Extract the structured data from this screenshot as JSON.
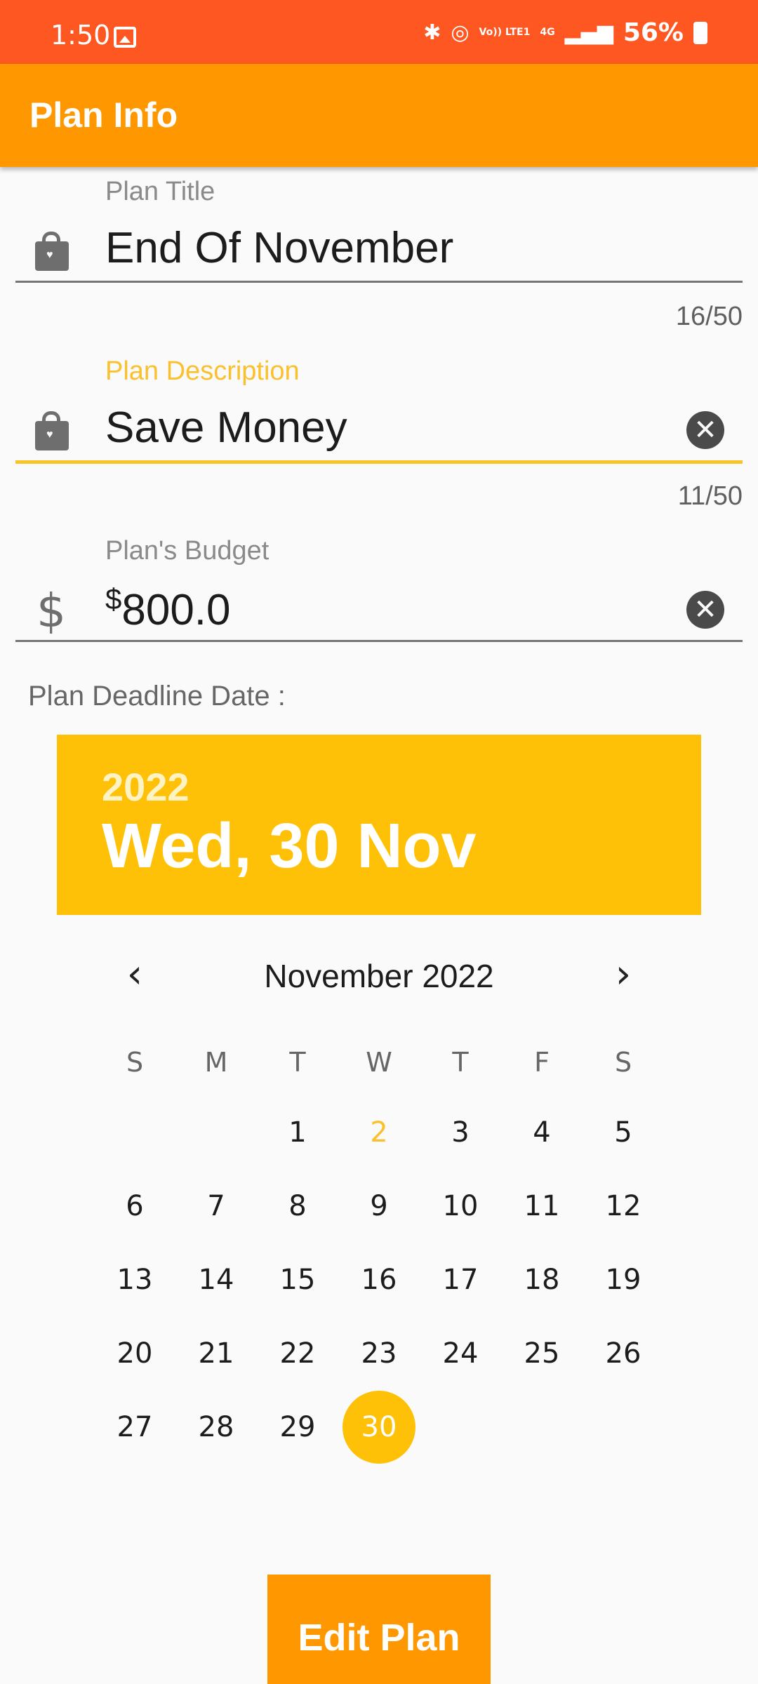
{
  "status_bar": {
    "time": "1:50",
    "battery": "56%",
    "network": "4G",
    "volte": "Vo)) LTE1"
  },
  "app_bar": {
    "title": "Plan Info"
  },
  "fields": {
    "title": {
      "label": "Plan Title",
      "value": "End Of November",
      "counter": "16/50",
      "icon": "shopping-bag-icon"
    },
    "description": {
      "label": "Plan Description",
      "value": "Save Money",
      "counter": "11/50",
      "icon": "shopping-bag-icon"
    },
    "budget": {
      "label": "Plan's Budget",
      "value": "800.0",
      "currency": "$",
      "icon": "dollar-icon"
    }
  },
  "deadline_label": "Plan Deadline Date :",
  "date_picker": {
    "year": "2022",
    "selected_date": "Wed, 30 Nov",
    "month_title": "November 2022",
    "weekdays": [
      "S",
      "M",
      "T",
      "W",
      "T",
      "F",
      "S"
    ],
    "first_weekday_index": 2,
    "days_in_month": 30,
    "today": 2,
    "selected_day": 30
  },
  "colors": {
    "status_bar": "#ff5722",
    "app_bar": "#ff9800",
    "accent": "#ffc107",
    "focus_label": "#fbc02d"
  },
  "edit_button": "Edit Plan"
}
